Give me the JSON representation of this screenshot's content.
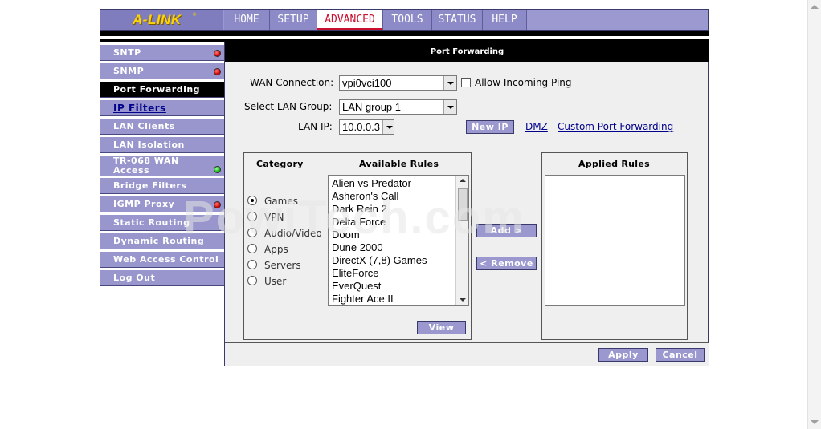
{
  "brand": {
    "logo": "A-LINK",
    "reg": "®"
  },
  "tabs": [
    {
      "label": "HOME"
    },
    {
      "label": "SETUP"
    },
    {
      "label": "ADVANCED"
    },
    {
      "label": "TOOLS"
    },
    {
      "label": "STATUS"
    },
    {
      "label": "HELP"
    }
  ],
  "sidebar": {
    "items": [
      {
        "label": "SNTP",
        "status": "red"
      },
      {
        "label": "SNMP",
        "status": "red"
      },
      {
        "label": "Port Forwarding"
      },
      {
        "label": "IP Filters"
      },
      {
        "label": "LAN Clients"
      },
      {
        "label": "LAN Isolation"
      },
      {
        "label": "TR-068 WAN Access",
        "status": "green"
      },
      {
        "label": "Bridge Filters"
      },
      {
        "label": "IGMP Proxy",
        "status": "red"
      },
      {
        "label": "Static Routing"
      },
      {
        "label": "Dynamic Routing"
      },
      {
        "label": "Web Access Control"
      },
      {
        "label": "Log Out"
      }
    ]
  },
  "main": {
    "title": "Port Forwarding",
    "wan_label": "WAN Connection:",
    "wan_value": "vpi0vci100",
    "allow_ping_label": "Allow Incoming Ping",
    "lan_group_label": "Select LAN Group:",
    "lan_group_value": "LAN group 1",
    "lan_ip_label": "LAN IP:",
    "lan_ip_value": "10.0.0.3",
    "new_ip_button": "New IP",
    "dmz_link": "DMZ",
    "custom_link": "Custom Port Forwarding",
    "category_title": "Category",
    "available_title": "Available Rules",
    "applied_title": "Applied Rules",
    "categories": [
      "Games",
      "VPN",
      "Audio/Video",
      "Apps",
      "Servers",
      "User"
    ],
    "selected_category": "Games",
    "rules": [
      "Alien vs Predator",
      "Asheron's Call",
      "Dark Rein 2",
      "Delta Force",
      "Doom",
      "Dune 2000",
      "DirectX (7,8) Games",
      "EliteForce",
      "EverQuest",
      "Fighter Ace II"
    ],
    "view_button": "View",
    "add_button": "Add >",
    "remove_button": "< Remove",
    "apply_button": "Apply",
    "cancel_button": "Cancel"
  },
  "watermark": "PowiTech.com",
  "colors": {
    "nav": "#9896cc",
    "active_tab_text": "#c8102e",
    "logo_text": "#ffd400"
  }
}
